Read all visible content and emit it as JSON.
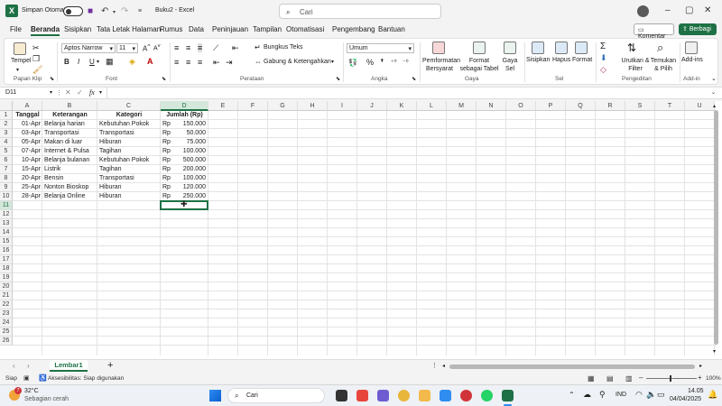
{
  "titlebar": {
    "autosave_label": "Simpan Otomatis",
    "doc_title": "Buku2 - Excel",
    "search_placeholder": "Cari"
  },
  "menu": [
    "File",
    "Beranda",
    "Sisipkan",
    "Tata Letak Halaman",
    "Rumus",
    "Data",
    "Peninjauan",
    "Tampilan",
    "Otomatisasi",
    "Pengembang",
    "Bantuan"
  ],
  "menu_active": "Beranda",
  "actions": {
    "comment": "Komentar",
    "share": "Berbagi"
  },
  "ribbon": {
    "clipboard": {
      "paste": "Tempel",
      "label": "Papan Klip"
    },
    "font": {
      "name": "Aptos Narrow",
      "size": "11",
      "bold": "B",
      "italic": "I",
      "underline": "U",
      "label": "Font"
    },
    "alignment": {
      "wrap": "Bungkus Teks",
      "merge": "Gabung & Ketengahkan",
      "label": "Perataan"
    },
    "number": {
      "format": "Umum",
      "label": "Angka"
    },
    "styles": {
      "conditional": "Pemformatan Bersyarat",
      "table": "Format sebagai Tabel",
      "cell": "Gaya Sel",
      "label": "Gaya"
    },
    "cells": {
      "insert": "Sisipkan",
      "delete": "Hapus",
      "format": "Format",
      "label": "Sel"
    },
    "editing": {
      "sort": "Urutkan & Filter",
      "find": "Temukan & Pilih",
      "label": "Pengeditan"
    },
    "addins": {
      "button": "Add-ins",
      "label": "Add-in"
    }
  },
  "formula_bar": {
    "name_box": "D11",
    "fx": "fx",
    "content": ""
  },
  "columns": [
    "A",
    "B",
    "C",
    "D",
    "E",
    "F",
    "G",
    "H",
    "I",
    "J",
    "K",
    "L",
    "M",
    "N",
    "O",
    "P",
    "Q",
    "R",
    "S",
    "T",
    "U"
  ],
  "selected_column": "D",
  "row_count": 26,
  "selected_row": 11,
  "table": {
    "headers": [
      "Tanggal",
      "Keterangan",
      "Kategori",
      "Jumlah (Rp)"
    ],
    "currency": "Rp",
    "rows": [
      [
        "01-Apr",
        "Belanja harian",
        "Kebutuhan Pokok",
        "150.000"
      ],
      [
        "03-Apr",
        "Transportasi",
        "Transportasi",
        "50.000"
      ],
      [
        "05-Apr",
        "Makan di luar",
        "Hiburan",
        "75.000"
      ],
      [
        "07-Apr",
        "Internet & Pulsa",
        "Tagihan",
        "100.000"
      ],
      [
        "10-Apr",
        "Belanja bulanan",
        "Kebutuhan Pokok",
        "500.000"
      ],
      [
        "15-Apr",
        "Listrik",
        "Tagihan",
        "200.000"
      ],
      [
        "20-Apr",
        "Bensin",
        "Transportasi",
        "100.000"
      ],
      [
        "25-Apr",
        "Nonton Bioskop",
        "Hiburan",
        "120.000"
      ],
      [
        "28-Apr",
        "Belanja Online",
        "Hiburan",
        "250.000"
      ]
    ]
  },
  "sheet": {
    "name": "Lembar1"
  },
  "status": {
    "ready": "Siap",
    "accessibility": "Aksesibilitas: Siap digunakan",
    "zoom": "100%"
  },
  "taskbar": {
    "weather_temp": "32°C",
    "weather_desc": "Sebagian cerah",
    "search": "Cari",
    "lang": "IND",
    "time": "14.05",
    "date": "04/04/2025",
    "badge": "7"
  },
  "colors": {
    "accent": "#1e7145"
  }
}
